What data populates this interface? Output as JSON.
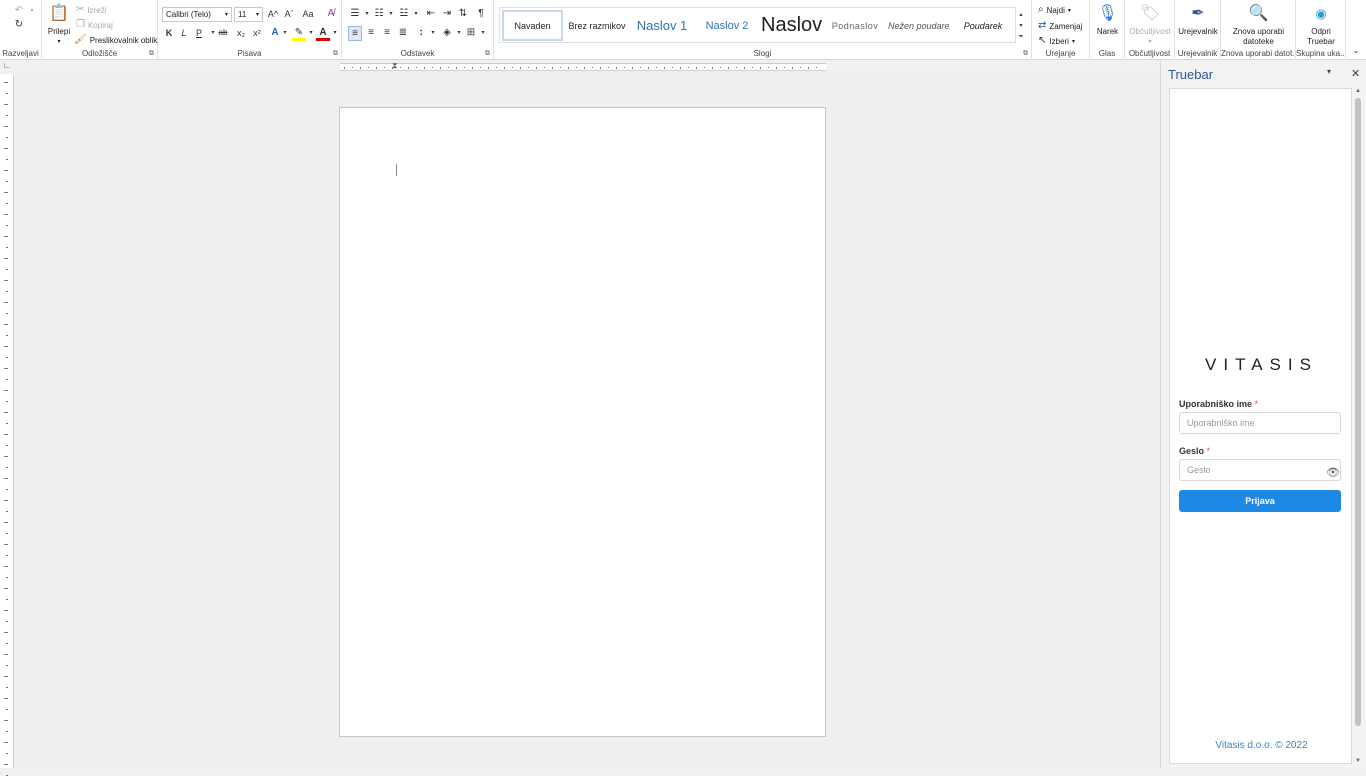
{
  "ribbon": {
    "undo": {
      "label": "Razveljavi"
    },
    "clipboard": {
      "label": "Odložišče",
      "paste": "Prilepi",
      "cut": "Izreži",
      "copy": "Kopiraj",
      "format_painter": "Preslikovalnik oblik"
    },
    "font": {
      "label": "Pisava",
      "family": "Calibri (Telo)",
      "size": "11",
      "bold": "K",
      "italic": "L",
      "underline": "P",
      "strike": "ab",
      "subscript": "x₂",
      "superscript": "x²",
      "case": "Aa",
      "grow": "A^",
      "shrink": "Aˇ"
    },
    "paragraph": {
      "label": "Odstavek"
    },
    "styles": {
      "label": "Slogi",
      "items": [
        "Navaden",
        "Brez razmikov",
        "Naslov 1",
        "Naslov 2",
        "Naslov",
        "Podnaslov",
        "Nežen poudarek",
        "Poudarek"
      ]
    },
    "editing": {
      "label": "Urejanje",
      "find": "Najdi",
      "replace": "Zamenjaj",
      "select": "Izberi"
    },
    "voice": {
      "label": "Glas",
      "dictate": "Narek"
    },
    "sensitivity": {
      "label": "Občutljivost",
      "button": "Občutljivost"
    },
    "editor": {
      "label": "Urejevalnik",
      "button": "Urejevalnik"
    },
    "reuse": {
      "label": "Znova uporabi datot...",
      "button_line1": "Znova uporabi",
      "button_line2": "datoteke"
    },
    "addin": {
      "label": "Skupina uka...",
      "button_line1": "Odpri",
      "button_line2": "Truebar"
    }
  },
  "pane": {
    "title": "Truebar",
    "logo": "VITASIS",
    "username_label": "Uporabniško ime",
    "username_placeholder": "Uporabniško ime",
    "password_label": "Geslo",
    "password_placeholder": "Geslo",
    "required_mark": "*",
    "login_button": "Prijava",
    "copyright": "Vitasis d.o.o. © 2022"
  },
  "colors": {
    "accent": "#2b579a",
    "login": "#1e88e5",
    "required": "#d9534f"
  }
}
